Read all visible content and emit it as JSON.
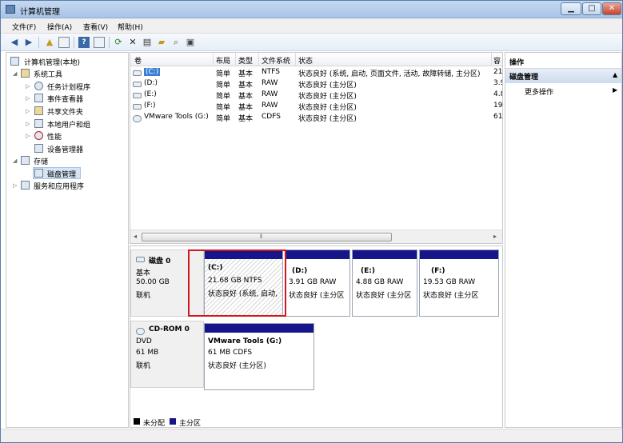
{
  "window": {
    "title": "计算机管理",
    "minimize": "▁",
    "maximize": "□",
    "close": "✕"
  },
  "menu": [
    "文件(F)",
    "操作(A)",
    "查看(V)",
    "帮助(H)"
  ],
  "tree": {
    "root": "计算机管理(本地)",
    "system_tools": "系统工具",
    "task_scheduler": "任务计划程序",
    "event_viewer": "事件查看器",
    "shared_folders": "共享文件夹",
    "local_users": "本地用户和组",
    "performance": "性能",
    "device_manager": "设备管理器",
    "storage": "存储",
    "disk_management": "磁盘管理",
    "services_apps": "服务和应用程序"
  },
  "volumes": {
    "columns": [
      "卷",
      "布局",
      "类型",
      "文件系统",
      "状态",
      "容"
    ],
    "rows": [
      {
        "vol": "(C:)",
        "layout": "简单",
        "type": "基本",
        "fs": "NTFS",
        "status": "状态良好 (系统, 启动, 页面文件, 活动, 故障转储, 主分区)",
        "cap": "21"
      },
      {
        "vol": "(D:)",
        "layout": "简单",
        "type": "基本",
        "fs": "RAW",
        "status": "状态良好 (主分区)",
        "cap": "3.9"
      },
      {
        "vol": "(E:)",
        "layout": "简单",
        "type": "基本",
        "fs": "RAW",
        "status": "状态良好 (主分区)",
        "cap": "4.8"
      },
      {
        "vol": "(F:)",
        "layout": "简单",
        "type": "基本",
        "fs": "RAW",
        "status": "状态良好 (主分区)",
        "cap": "19"
      },
      {
        "vol": "VMware Tools (G:)",
        "layout": "简单",
        "type": "基本",
        "fs": "CDFS",
        "status": "状态良好 (主分区)",
        "cap": "61"
      }
    ]
  },
  "disk0": {
    "name": "磁盘 0",
    "type": "基本",
    "size": "50.00 GB",
    "state": "联机",
    "partitions": [
      {
        "label": "(C:)",
        "size": "21.68 GB NTFS",
        "status": "状态良好 (系统, 启动,"
      },
      {
        "label": "(D:)",
        "size": "3.91 GB RAW",
        "status": "状态良好 (主分区"
      },
      {
        "label": "(E:)",
        "size": "4.88 GB RAW",
        "status": "状态良好 (主分区"
      },
      {
        "label": "(F:)",
        "size": "19.53 GB RAW",
        "status": "状态良好 (主分区"
      }
    ]
  },
  "cdrom0": {
    "name": "CD-ROM 0",
    "type": "DVD",
    "size": "61 MB",
    "state": "联机",
    "partition": {
      "label": "VMware Tools  (G:)",
      "size": "61 MB CDFS",
      "status": "状态良好 (主分区)"
    }
  },
  "legend": {
    "unallocated": "未分配",
    "primary": "主分区"
  },
  "actions": {
    "header": "操作",
    "group": "磁盘管理",
    "more": "更多操作"
  },
  "colors": {
    "primary_partition": "#16168a",
    "highlight_box": "#d2161c"
  }
}
